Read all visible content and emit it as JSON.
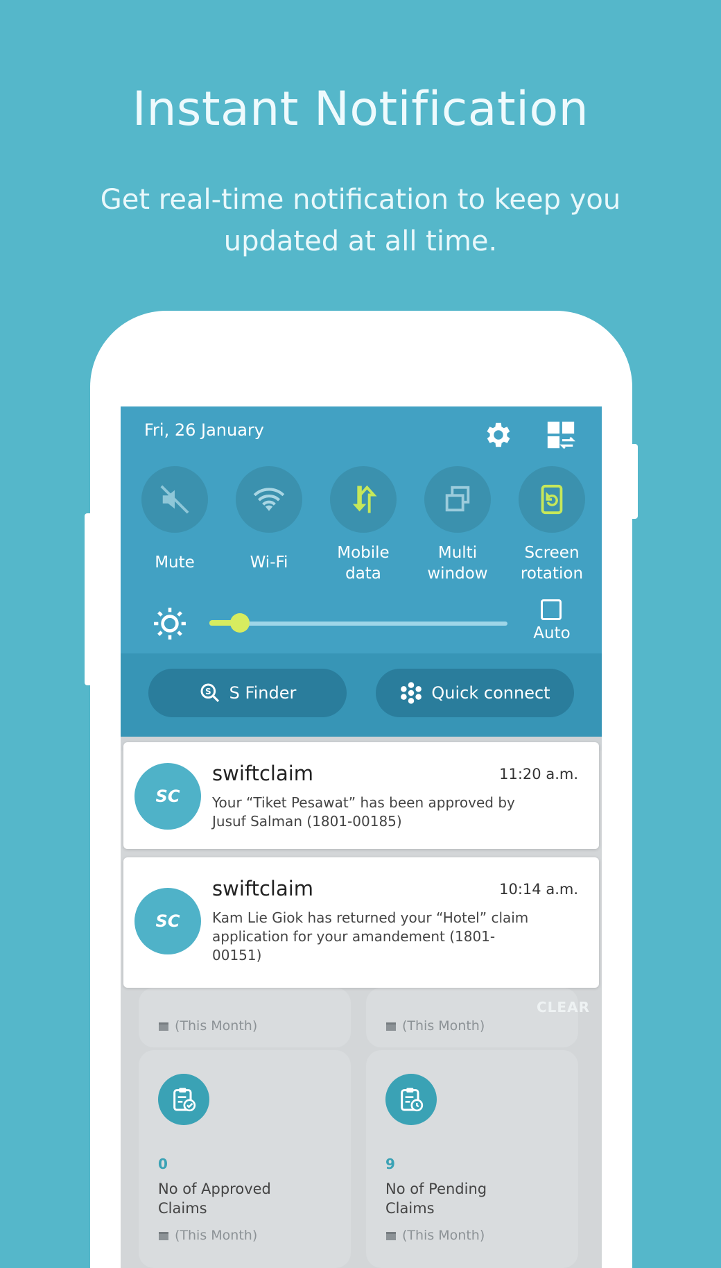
{
  "hero": {
    "title": "Instant Notification",
    "subtitle": "Get real-time notification to keep you updated at all time."
  },
  "quick_panel": {
    "date": "Fri, 26 January",
    "settings_icon": "gear-icon",
    "edit_icon": "grid-edit-icon",
    "tiles": [
      {
        "label": "Mute",
        "icon": "mute-icon"
      },
      {
        "label": "Wi-Fi",
        "icon": "wifi-icon"
      },
      {
        "label": "Mobile data",
        "icon": "mobile-data-icon"
      },
      {
        "label": "Multi window",
        "icon": "multi-window-icon"
      },
      {
        "label": "Screen rotation",
        "icon": "screen-rotation-icon"
      }
    ],
    "brightness": {
      "level": 0.09,
      "auto_label": "Auto",
      "auto_checked": false
    },
    "buttons": {
      "sfinder": "S Finder",
      "quick_connect": "Quick connect"
    }
  },
  "notifications": [
    {
      "app": "swiftclaim",
      "logo_text": "SC",
      "time": "11:20 a.m.",
      "message": "Your “Tiket Pesawat” has been approved by Jusuf Salman (1801-00185)"
    },
    {
      "app": "swiftclaim",
      "logo_text": "SC",
      "time": "10:14 a.m.",
      "message": "Kam Lie Giok has returned your “Hotel” claim application for your amandement (1801-00151)"
    }
  ],
  "clear_label": "CLEAR",
  "dashboard": {
    "month_label": "(This Month)",
    "cards": [
      {
        "count": "0",
        "title": "No of Approved Claims"
      },
      {
        "count": "9",
        "title": "No of Pending Claims"
      }
    ]
  },
  "colors": {
    "background": "#55b7ca",
    "panel": "#42a1c3",
    "accent": "#3aa2b5",
    "slider": "#d7ec5f"
  }
}
